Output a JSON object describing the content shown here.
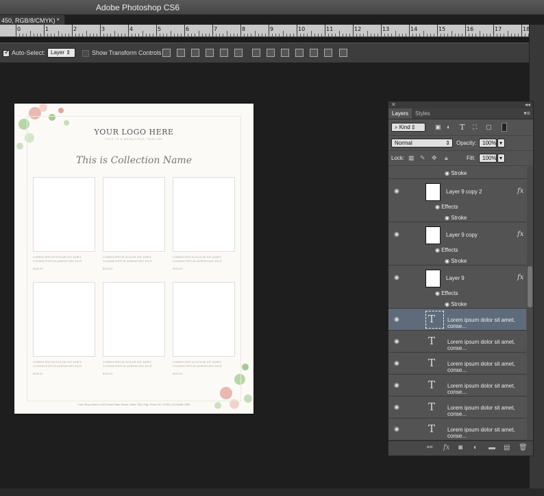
{
  "app": {
    "title": "Adobe Photoshop CS6",
    "doc_tab": "450, RGB/8/CMYK) *"
  },
  "ruler": {
    "labels": [
      "0",
      "1",
      "2",
      "3",
      "4",
      "5",
      "6",
      "7",
      "8",
      "9",
      "10",
      "11",
      "12",
      "13",
      "14",
      "15",
      "16",
      "17",
      "18"
    ]
  },
  "options_bar": {
    "auto_select_label": "Auto-Select:",
    "auto_select_checked": true,
    "auto_select_value": "Layer",
    "transform_label": "Show Transform Controls",
    "transform_checked": false
  },
  "document": {
    "logo": "YOUR LOGO HERE",
    "tagline": "THIS IS A BEAUTIFUL TAGLINE",
    "collection": "This is Collection Name",
    "product_text": "LOREM IPSUM DOLOR SIT AMET, CONSECTETUR ADIPISCING ELIT.",
    "price": "$100.00",
    "footer": "Your Shop Name  |  123 South Plain Street, Suite 700  |  High Point, NC 27262  |  (123)456-7890"
  },
  "layers_panel": {
    "close": "✕",
    "collapse": "◂◂",
    "tabs": [
      "Layers",
      "Styles"
    ],
    "kind_label": "Kind",
    "blend_mode": "Normal",
    "opacity_label": "Opacity:",
    "opacity_value": "100%",
    "lock_label": "Lock:",
    "fill_label": "Fill:",
    "fill_value": "100%",
    "stroke_top": "Stroke",
    "layer1": {
      "name": "Layer 9 copy 2",
      "effects": "Effects",
      "stroke": "Stroke"
    },
    "layer2": {
      "name": "Layer 9 copy",
      "effects": "Effects",
      "stroke": "Stroke"
    },
    "layer3": {
      "name": "Layer 9",
      "effects": "Effects",
      "stroke": "Stroke"
    },
    "text_layer_name": "Lorem ipsum dolor sit amet, conse...",
    "fx_label": "fx",
    "text_icon": "T"
  }
}
